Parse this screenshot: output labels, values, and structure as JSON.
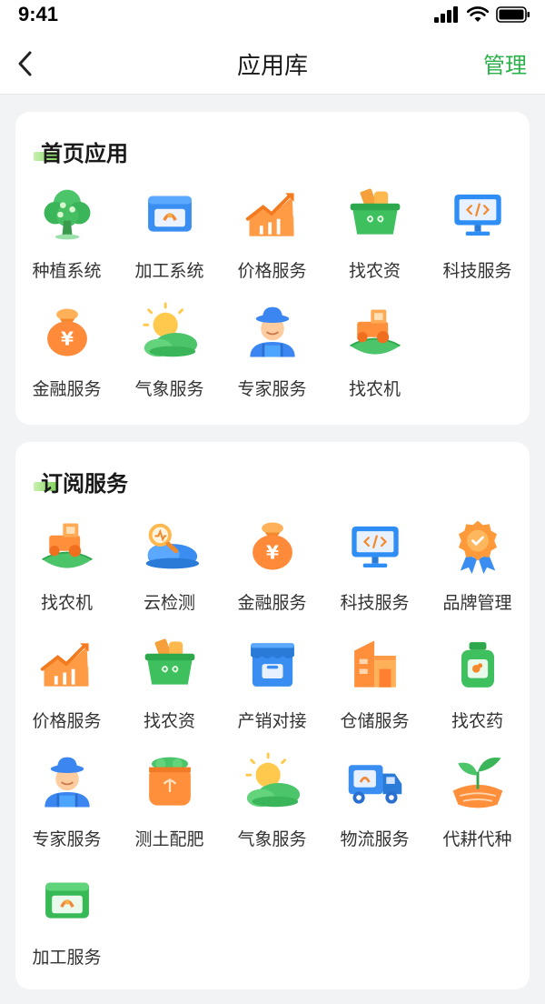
{
  "status_bar": {
    "time": "9:41"
  },
  "nav": {
    "title": "应用库",
    "manage_label": "管理"
  },
  "sections": {
    "home": {
      "title": "首页应用",
      "apps": [
        {
          "label": "种植系统",
          "icon": "tree-icon"
        },
        {
          "label": "加工系统",
          "icon": "processing-box-icon"
        },
        {
          "label": "价格服务",
          "icon": "price-trend-icon"
        },
        {
          "label": "找农资",
          "icon": "basket-icon"
        },
        {
          "label": "科技服务",
          "icon": "monitor-code-icon"
        },
        {
          "label": "金融服务",
          "icon": "money-bag-icon"
        },
        {
          "label": "气象服务",
          "icon": "weather-icon"
        },
        {
          "label": "专家服务",
          "icon": "farmer-icon"
        },
        {
          "label": "找农机",
          "icon": "tractor-icon"
        }
      ]
    },
    "subscribed": {
      "title": "订阅服务",
      "apps": [
        {
          "label": "找农机",
          "icon": "tractor-icon"
        },
        {
          "label": "云检测",
          "icon": "cloud-search-icon"
        },
        {
          "label": "金融服务",
          "icon": "money-bag-icon"
        },
        {
          "label": "科技服务",
          "icon": "monitor-code-icon"
        },
        {
          "label": "品牌管理",
          "icon": "badge-icon"
        },
        {
          "label": "价格服务",
          "icon": "price-trend-icon"
        },
        {
          "label": "找农资",
          "icon": "basket-icon"
        },
        {
          "label": "产销对接",
          "icon": "store-icon"
        },
        {
          "label": "仓储服务",
          "icon": "warehouse-icon"
        },
        {
          "label": "找农药",
          "icon": "pesticide-jar-icon"
        },
        {
          "label": "专家服务",
          "icon": "farmer-icon"
        },
        {
          "label": "测土配肥",
          "icon": "fertilizer-sack-icon"
        },
        {
          "label": "气象服务",
          "icon": "weather-icon"
        },
        {
          "label": "物流服务",
          "icon": "truck-icon"
        },
        {
          "label": "代耕代种",
          "icon": "sprout-icon"
        },
        {
          "label": "加工服务",
          "icon": "processing-box-green-icon"
        }
      ]
    }
  },
  "colors": {
    "accent": "#2bb04a",
    "background": "#f2f3f5",
    "card": "#ffffff"
  }
}
